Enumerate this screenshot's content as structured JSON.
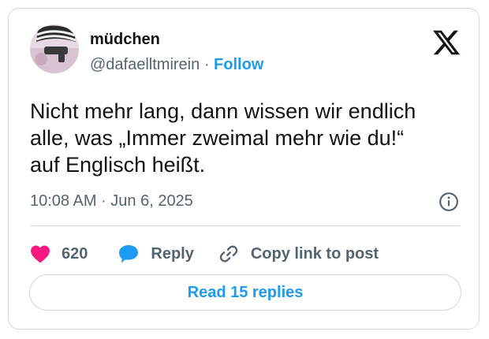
{
  "author": {
    "display_name": "müdchen",
    "handle": "@dafaelltmirein",
    "separator": "·",
    "follow_label": "Follow"
  },
  "tweet": {
    "text": "Nicht mehr lang, dann wissen wir endlich\nalle, was „Immer zweimal mehr wie du!“\nauf Englisch heißt.",
    "timestamp": "10:08 AM · Jun 6, 2025"
  },
  "actions": {
    "like_count": "620",
    "reply_label": "Reply",
    "copy_link_label": "Copy link to post"
  },
  "read_replies_label": "Read 15 replies",
  "icons": {
    "brand": "x-logo-icon",
    "info": "info-icon",
    "like": "heart-icon",
    "reply": "speech-bubble-icon",
    "copy": "link-icon"
  },
  "colors": {
    "accent": "#1d9bf0",
    "like": "#f91880",
    "secondary_text": "#536471",
    "border": "#cfd9de"
  }
}
